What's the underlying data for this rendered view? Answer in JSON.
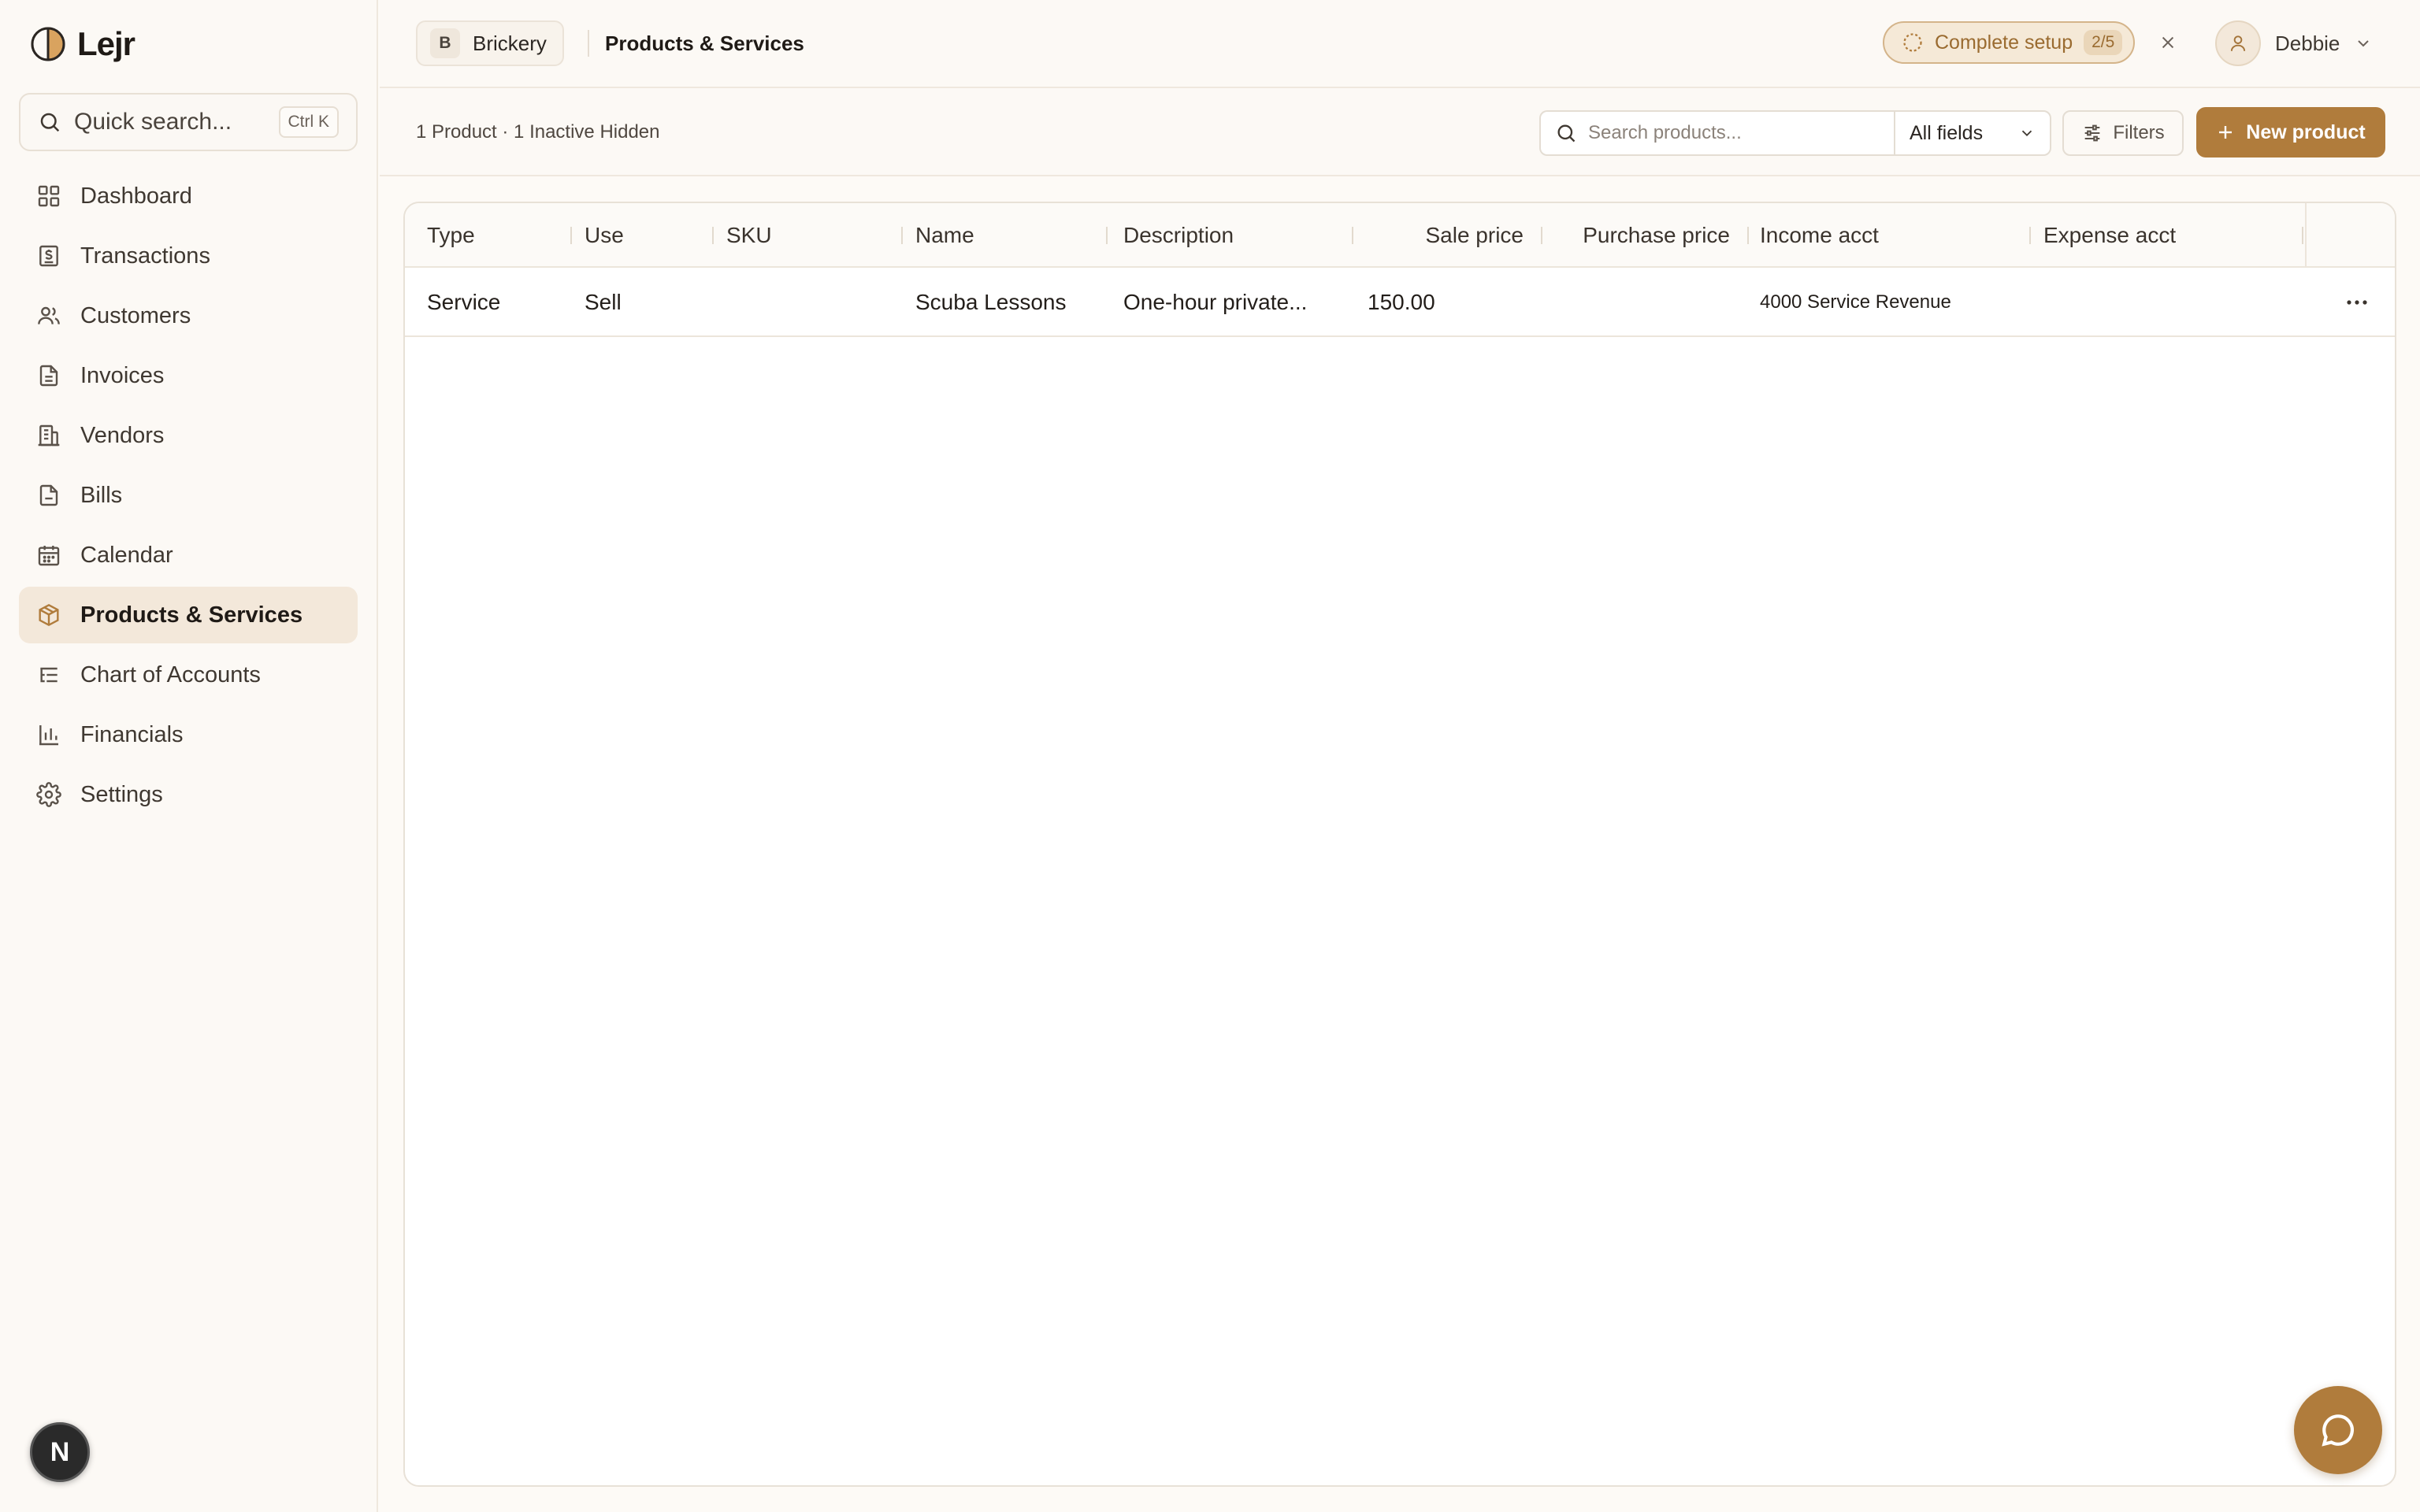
{
  "app": {
    "name": "Lejr"
  },
  "sidebar": {
    "quick_search": {
      "label": "Quick search...",
      "shortcut": "Ctrl K"
    },
    "items": [
      {
        "label": "Dashboard",
        "icon": "grid-icon"
      },
      {
        "label": "Transactions",
        "icon": "receipt-icon"
      },
      {
        "label": "Customers",
        "icon": "users-icon"
      },
      {
        "label": "Invoices",
        "icon": "file-text-icon"
      },
      {
        "label": "Vendors",
        "icon": "building-icon"
      },
      {
        "label": "Bills",
        "icon": "file-icon"
      },
      {
        "label": "Calendar",
        "icon": "calendar-icon"
      },
      {
        "label": "Products & Services",
        "icon": "package-icon",
        "active": true
      },
      {
        "label": "Chart of Accounts",
        "icon": "list-tree-icon"
      },
      {
        "label": "Financials",
        "icon": "bar-chart-icon"
      },
      {
        "label": "Settings",
        "icon": "gear-icon"
      }
    ],
    "badge": "N"
  },
  "topbar": {
    "workspace": {
      "initial": "B",
      "name": "Brickery"
    },
    "breadcrumb": "Products & Services",
    "setup": {
      "label": "Complete setup",
      "progress": "2/5"
    },
    "user": {
      "name": "Debbie"
    }
  },
  "toolbar": {
    "summary": "1 Product · 1 Inactive Hidden",
    "search_placeholder": "Search products...",
    "field_filter": "All fields",
    "filters_label": "Filters",
    "new_label": "New product"
  },
  "table": {
    "columns": [
      "Type",
      "Use",
      "SKU",
      "Name",
      "Description",
      "Sale price",
      "Purchase price",
      "Income acct",
      "Expense acct"
    ],
    "rows": [
      {
        "type": "Service",
        "use": "Sell",
        "sku": "",
        "name": "Scuba Lessons",
        "description": "One-hour private...",
        "sale_price": "150.00",
        "purchase_price": "",
        "income_acct": "4000 Service Revenue",
        "expense_acct": ""
      }
    ]
  },
  "colors": {
    "accent": "#b07c3c",
    "active_bg": "#f3e8da",
    "page_bg": "#fdfaf6"
  }
}
